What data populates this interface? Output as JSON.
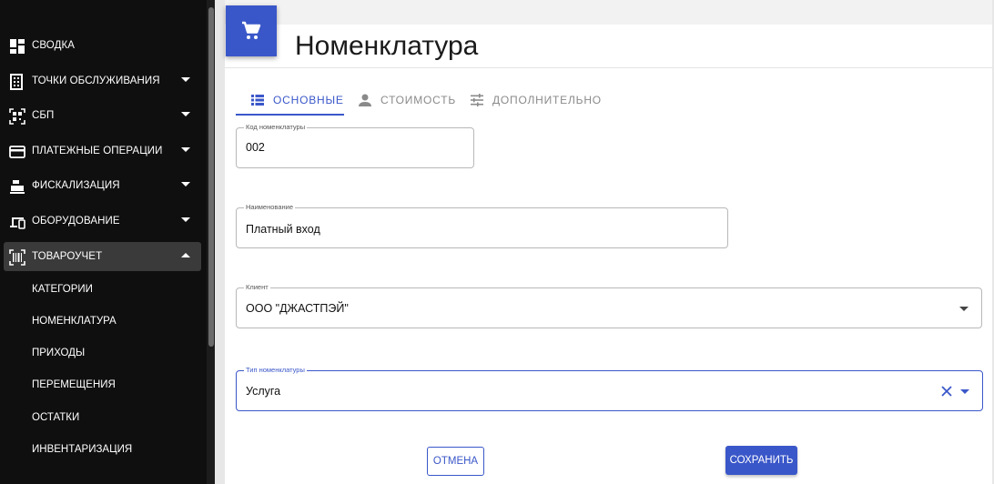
{
  "sidebar": {
    "items": [
      {
        "label": "СВОДКА",
        "icon": "dashboard-icon",
        "expandable": false
      },
      {
        "label": "ТОЧКИ ОБСЛУЖИВАНИЯ",
        "icon": "building-icon",
        "expandable": true
      },
      {
        "label": "СБП",
        "icon": "qr-code-icon",
        "expandable": true
      },
      {
        "label": "ПЛАТЕЖНЫЕ ОПЕРАЦИИ",
        "icon": "credit-card-icon",
        "expandable": true
      },
      {
        "label": "ФИСКАЛИЗАЦИЯ",
        "icon": "cash-register-icon",
        "expandable": true
      },
      {
        "label": "ОБОРУДОВАНИЕ",
        "icon": "devices-icon",
        "expandable": true
      },
      {
        "label": "ТОВАРОУЧЕТ",
        "icon": "barcode-icon",
        "expandable": true,
        "expanded": true
      }
    ],
    "subitems": [
      "КАТЕГОРИИ",
      "НОМЕНКЛАТУРА",
      "ПРИХОДЫ",
      "ПЕРЕМЕЩЕНИЯ",
      "ОСТАТКИ",
      "ИНВЕНТАРИЗАЦИЯ"
    ]
  },
  "header": {
    "title": "Номенклатура",
    "icon": "shopping-cart-icon"
  },
  "tabs": [
    {
      "label": "ОСНОВНЫЕ",
      "icon": "list-icon",
      "active": true
    },
    {
      "label": "СТОИМОСТЬ",
      "icon": "person-icon",
      "active": false
    },
    {
      "label": "ДОПОЛНИТЕЛЬНО",
      "icon": "tune-icon",
      "active": false
    }
  ],
  "form": {
    "code": {
      "label": "Код номенклатуры",
      "value": "002"
    },
    "name": {
      "label": "Наименование",
      "value": "Платный вход"
    },
    "client": {
      "label": "Клиент",
      "value": "ООО \"ДЖАСТПЭЙ\""
    },
    "type": {
      "label": "Тип номенклатуры",
      "value": "Услуга"
    }
  },
  "buttons": {
    "cancel": "ОТМЕНА",
    "save": "СОХРАНИТЬ"
  },
  "colors": {
    "accent": "#3a57c9",
    "sidebar_bg": "#0f0f0f",
    "active_item_bg": "#3a3a3a"
  }
}
